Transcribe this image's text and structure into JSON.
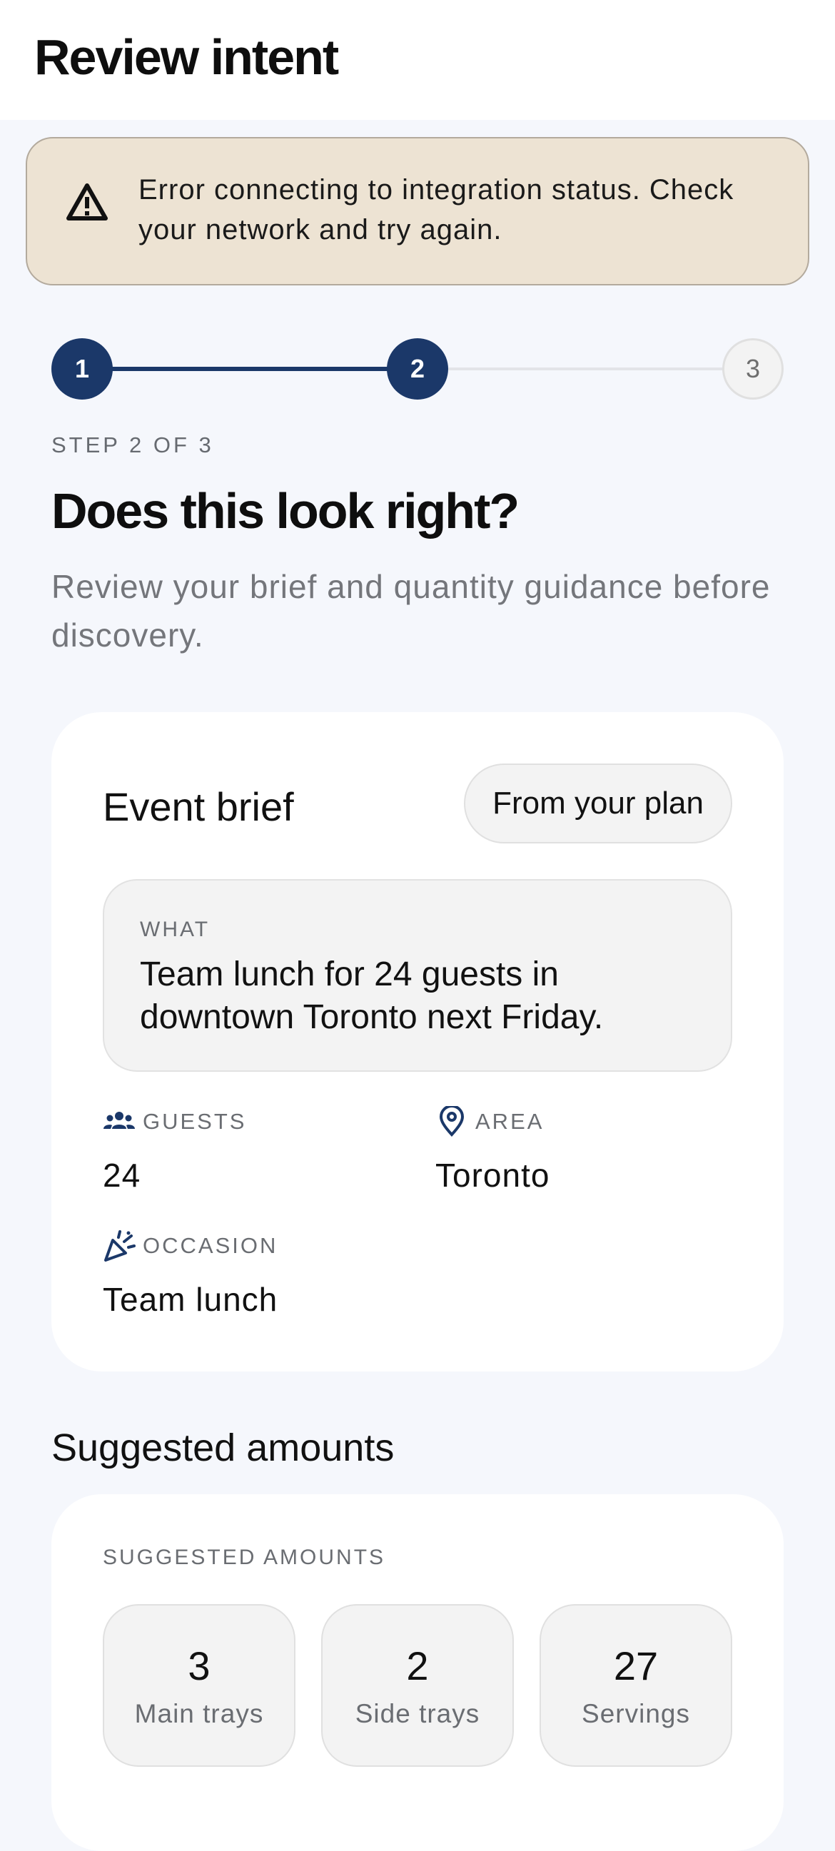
{
  "header": {
    "title": "Review intent"
  },
  "alert": {
    "icon": "warning-triangle-icon",
    "message": "Error connecting to integration status. Check your network and try again."
  },
  "stepper": {
    "current": 2,
    "total": 3,
    "steps": [
      {
        "label": "1",
        "state": "complete"
      },
      {
        "label": "2",
        "state": "current"
      },
      {
        "label": "3",
        "state": "upcoming"
      }
    ],
    "step_label": "STEP 2 OF 3"
  },
  "page": {
    "heading": "Does this look right?",
    "subtitle": "Review your brief and quantity guidance before discovery."
  },
  "brief": {
    "title": "Event brief",
    "source_pill": "From your plan",
    "what_label": "WHAT",
    "what_value": "Team lunch for 24 guests in downtown Toronto next Friday.",
    "guests": {
      "icon": "people-icon",
      "label": "GUESTS",
      "value": "24"
    },
    "area": {
      "icon": "location-pin-icon",
      "label": "AREA",
      "value": "Toronto"
    },
    "occasion": {
      "icon": "party-popper-icon",
      "label": "OCCASION",
      "value": "Team lunch"
    }
  },
  "amounts": {
    "section_heading": "Suggested amounts",
    "card_label": "SUGGESTED AMOUNTS",
    "items": [
      {
        "value": "3",
        "caption": "Main trays"
      },
      {
        "value": "2",
        "caption": "Side trays"
      },
      {
        "value": "27",
        "caption": "Servings"
      }
    ]
  },
  "colors": {
    "accent": "#1b3869",
    "alert_bg": "#ede3d3",
    "page_bg": "#f5f7fc"
  }
}
